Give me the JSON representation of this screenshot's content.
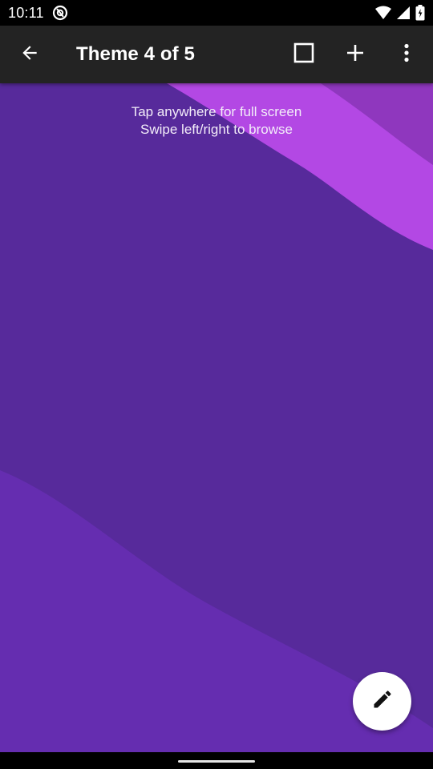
{
  "status_bar": {
    "time": "10:11",
    "icons": [
      "at-sign-icon",
      "wifi-icon",
      "signal-icon",
      "battery-icon"
    ]
  },
  "toolbar": {
    "title": "Theme 4 of 5",
    "actions": [
      "back-arrow-icon",
      "square-icon",
      "add-icon",
      "more-vert-icon"
    ]
  },
  "content": {
    "hint_line1": "Tap anywhere for full screen",
    "hint_line2": "Swipe left/right to browse"
  },
  "fab": {
    "icon": "edit-pencil-icon"
  },
  "colors": {
    "background": "#572a9b",
    "wave_light": "#b348e4",
    "wave_corner": "#8f37be",
    "wave_bottom": "#652db0",
    "toolbar": "#232323"
  }
}
